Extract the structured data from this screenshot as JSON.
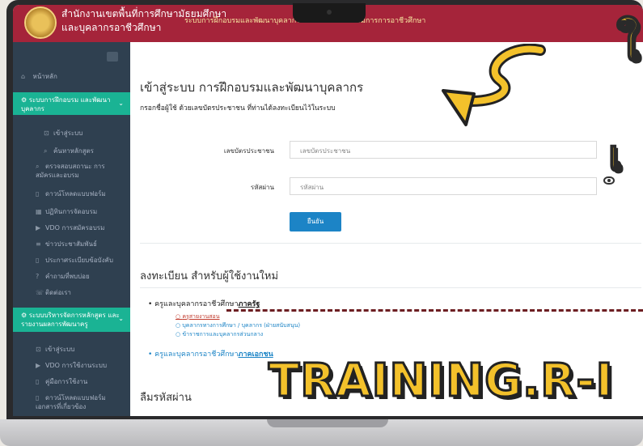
{
  "header": {
    "org_line1": "สำนักงานเขตพื้นที่การศึกษามัธยมศึกษา",
    "org_line2": "และบุคลากรอาชีวศึกษา",
    "title": "ระบบการฝึกอบรมและพัฒนาบุคลากร สำนักงานคณะกรรมการการอาชีวศึกษา"
  },
  "sidebar": {
    "home": "หน้าหลัก",
    "section1": "ระบบการฝึกอบรม และพัฒนาบุคลากร",
    "items1": [
      "เข้าสู่ระบบ",
      "ค้นหาหลักสูตร",
      "ตรวจสอบสถานะ การสมัครและอบรม",
      "ดาวน์โหลดแบบฟอร์ม",
      "ปฏิทินการจัดอบรม",
      "VDO การสมัครอบรม",
      "ข่าวประชาสัมพันธ์",
      "ประกาศระเบียบข้อบังคับ",
      "คำถามที่พบบ่อย",
      "ติดต่อเรา"
    ],
    "section2": "ระบบบริหารจัดการหลักสูตร และรายงานผลการพัฒนาครู",
    "items2": [
      "เข้าสู่ระบบ",
      "VDO การใช้งานระบบ",
      "คู่มือการใช้งาน",
      "ดาวน์โหลดแบบฟอร์ม เอกสารที่เกี่ยวข้อง"
    ]
  },
  "main": {
    "title": "เข้าสู่ระบบ การฝึกอบรมและพัฒนาบุคลากร",
    "subtitle": "กรอกชื่อผู้ใช้ ด้วยเลขบัตรประชาชน ที่ท่านได้ลงทะเบียนไว้ในระบบ",
    "id_label": "เลขบัตรประชาชน",
    "id_placeholder": "เลขบัตรประชาชน",
    "password_label": "รหัสผ่าน",
    "password_placeholder": "รหัสผ่าน",
    "confirm_button": "ยืนยัน",
    "register_title": "ลงทะเบียน สำหรับผู้ใช้งานใหม่",
    "register_gov_prefix": "ครูและบุคลากรอาชีวศึกษา",
    "register_gov_link": "ภาครัฐ",
    "register_gov_subs": [
      "ครูสายงานสอน",
      "บุคลากรทางการศึกษา / บุคลากร (ฝ่ายสนับสนุน)",
      "ข้าราชการและบุคลากรส่วนกลาง"
    ],
    "register_private_prefix": "ครูและบุคลากรอาชีวศึกษา",
    "register_private_link": "ภาคเอกชน",
    "forgot_title": "ลืมรหัสผ่าน"
  },
  "overlay": {
    "big_text": "TRAINING.R-I",
    "side_top": "ใ",
    "side_mid": "เ"
  },
  "colors": {
    "header": "#a5243a",
    "sidebar": "#2f4050",
    "active": "#1ab394",
    "button": "#1c84c6",
    "overlay_text": "#f3c12b"
  }
}
